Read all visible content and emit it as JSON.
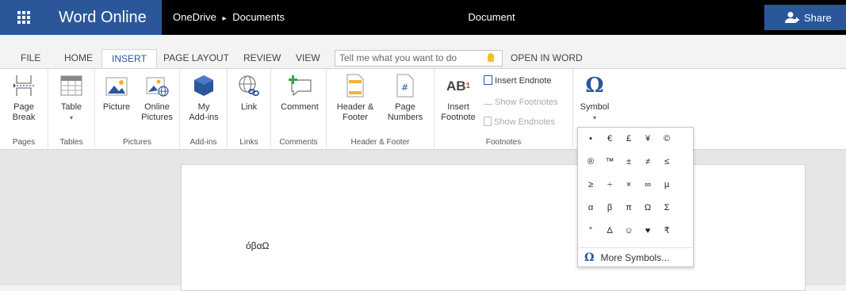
{
  "topbar": {
    "app_name": "Word Online",
    "breadcrumb_root": "OneDrive",
    "breadcrumb_sep": "▸",
    "breadcrumb_folder": "Documents",
    "document_title": "Document",
    "share_label": "Share"
  },
  "tabs": [
    "FILE",
    "HOME",
    "INSERT",
    "PAGE LAYOUT",
    "REVIEW",
    "VIEW"
  ],
  "active_tab": "INSERT",
  "tellme": {
    "placeholder": "Tell me what you want to do"
  },
  "open_in_word": "OPEN IN WORD",
  "ribbon": {
    "groups": {
      "pages": "Pages",
      "tables": "Tables",
      "pictures": "Pictures",
      "addins": "Add-ins",
      "links": "Links",
      "comments": "Comments",
      "header_footer": "Header & Footer",
      "footnotes": "Footnotes"
    },
    "buttons": {
      "page_break": "Page\nBreak",
      "table": "Table",
      "picture": "Picture",
      "online_pictures": "Online\nPictures",
      "my_addins": "My\nAdd-ins",
      "link": "Link",
      "comment": "Comment",
      "header_footer": "Header &\nFooter",
      "page_numbers": "Page\nNumbers",
      "insert_footnote": "Insert\nFootnote",
      "footnote_icon_text": "AB",
      "footnote_sup": "1",
      "insert_endnote": "Insert Endnote",
      "show_footnotes": "Show Footnotes",
      "show_endnotes": "Show Endnotes",
      "symbol": "Symbol",
      "symbol_glyph": "Ω"
    }
  },
  "symbol_panel": {
    "symbols": [
      "•",
      "€",
      "£",
      "¥",
      "©",
      "®",
      "™",
      "±",
      "≠",
      "≤",
      "≥",
      "÷",
      "×",
      "∞",
      "µ",
      "α",
      "β",
      "π",
      "Ω",
      "Σ",
      "°",
      "Δ",
      "☺",
      "♥",
      "₹"
    ],
    "more_glyph": "Ω",
    "more_label": "More Symbols..."
  },
  "document": {
    "text": "όβαΩ"
  },
  "colors": {
    "brand": "#2b579a",
    "topbar": "#000000",
    "ribbon_bg": "#ffffff",
    "canvas": "#e6e6e6"
  }
}
